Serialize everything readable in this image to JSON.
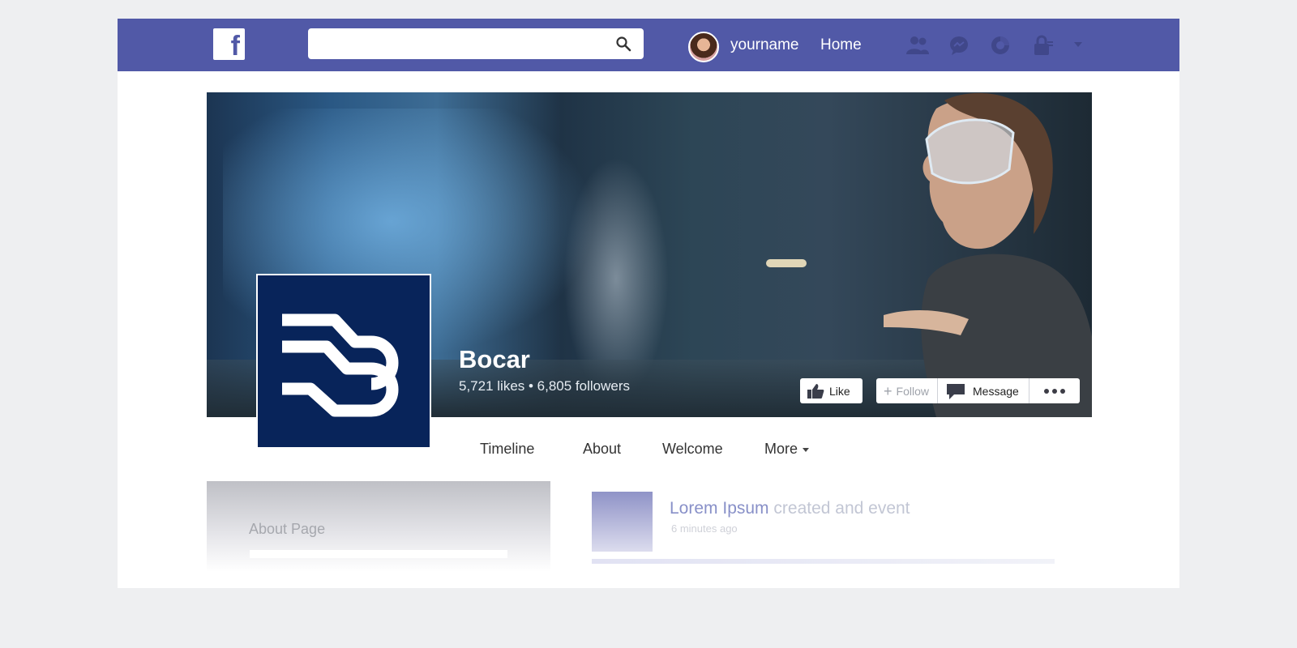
{
  "topbar": {
    "logo_letter": "f",
    "search_placeholder": "",
    "username": "yourname",
    "home_label": "Home",
    "icons": [
      "friends-icon",
      "messenger-icon",
      "notifications-icon",
      "privacy-icon",
      "dropdown-icon"
    ]
  },
  "page": {
    "name": "Bocar",
    "stats": "5,721 likes • 6,805 followers"
  },
  "actions": {
    "like_label": "Like",
    "follow_label": "Follow",
    "message_label": "Message"
  },
  "tabs": {
    "timeline": "Timeline",
    "about": "About",
    "welcome": "Welcome",
    "more": "More"
  },
  "about_card": {
    "title": "About Page"
  },
  "post": {
    "author": "Lorem Ipsum",
    "action": "created and event",
    "time": "6 minutes ago"
  },
  "colors": {
    "brand": "#5159a7",
    "page_bg": "#eeeff1",
    "logo_bg": "#08245a"
  }
}
